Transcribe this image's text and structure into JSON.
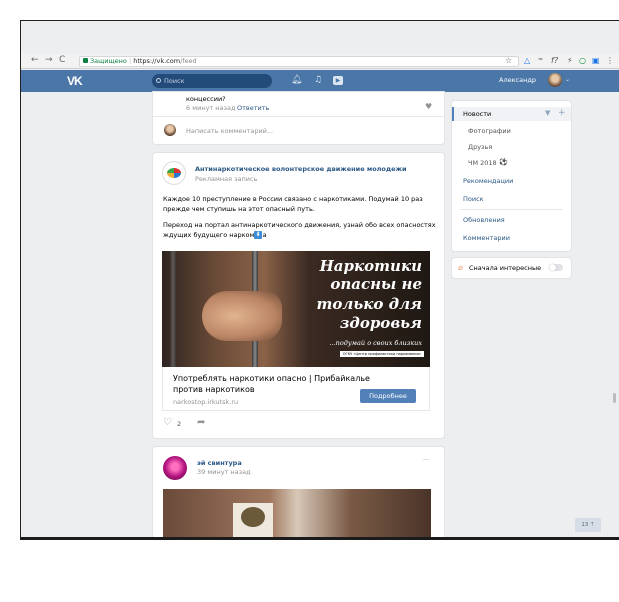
{
  "browser": {
    "secure_label": "Защищено",
    "url_host": "https://vk.com",
    "url_path": "/feed"
  },
  "vk": {
    "logo": "VK",
    "search_placeholder": "Поиск",
    "user_name": "Александр"
  },
  "comment_card": {
    "text_fragment": "концессии?",
    "time": "6 минут назад",
    "reply": "Ответить",
    "write_placeholder": "Написать комментарий..."
  },
  "ad_post": {
    "author": "Антинаркотическое волонтерское движение молодежи",
    "subtitle": "Рекламная запись",
    "text_line1": "Каждое 10 преступление в России связано с наркотиками. Подумай 10 раз",
    "text_line2": "прежде чем ступишь на этот опасный путь.",
    "text_line3": "Переход на портал антинаркотического движения, узнай обо всех опасностях",
    "text_line4": "ждущих будущего наркомана",
    "image_title_1": "Наркотики",
    "image_title_2": "опасны не",
    "image_title_3": "только для",
    "image_title_4": "здоровья",
    "image_sub": "...подумай о своих близких",
    "image_org": "ОГКУ «Центр профилактики наркомании»",
    "link_title_1": "Употреблять наркотики опасно | Прибайкалье",
    "link_title_2": "против наркотиков",
    "link_domain": "narkostop.irkutsk.ru",
    "button": "Подробнее",
    "likes": "2"
  },
  "post2": {
    "author": "эй свинтура",
    "time": "39 минут назад",
    "more": "···"
  },
  "menu": {
    "items": [
      "Новости",
      "Фотографии",
      "Друзья",
      "ЧМ 2018",
      "Рекомендации",
      "Поиск",
      "Обновления",
      "Комментарии"
    ],
    "interesting_first": "Сначала интересные"
  },
  "corner_badge": "13 ⇡"
}
